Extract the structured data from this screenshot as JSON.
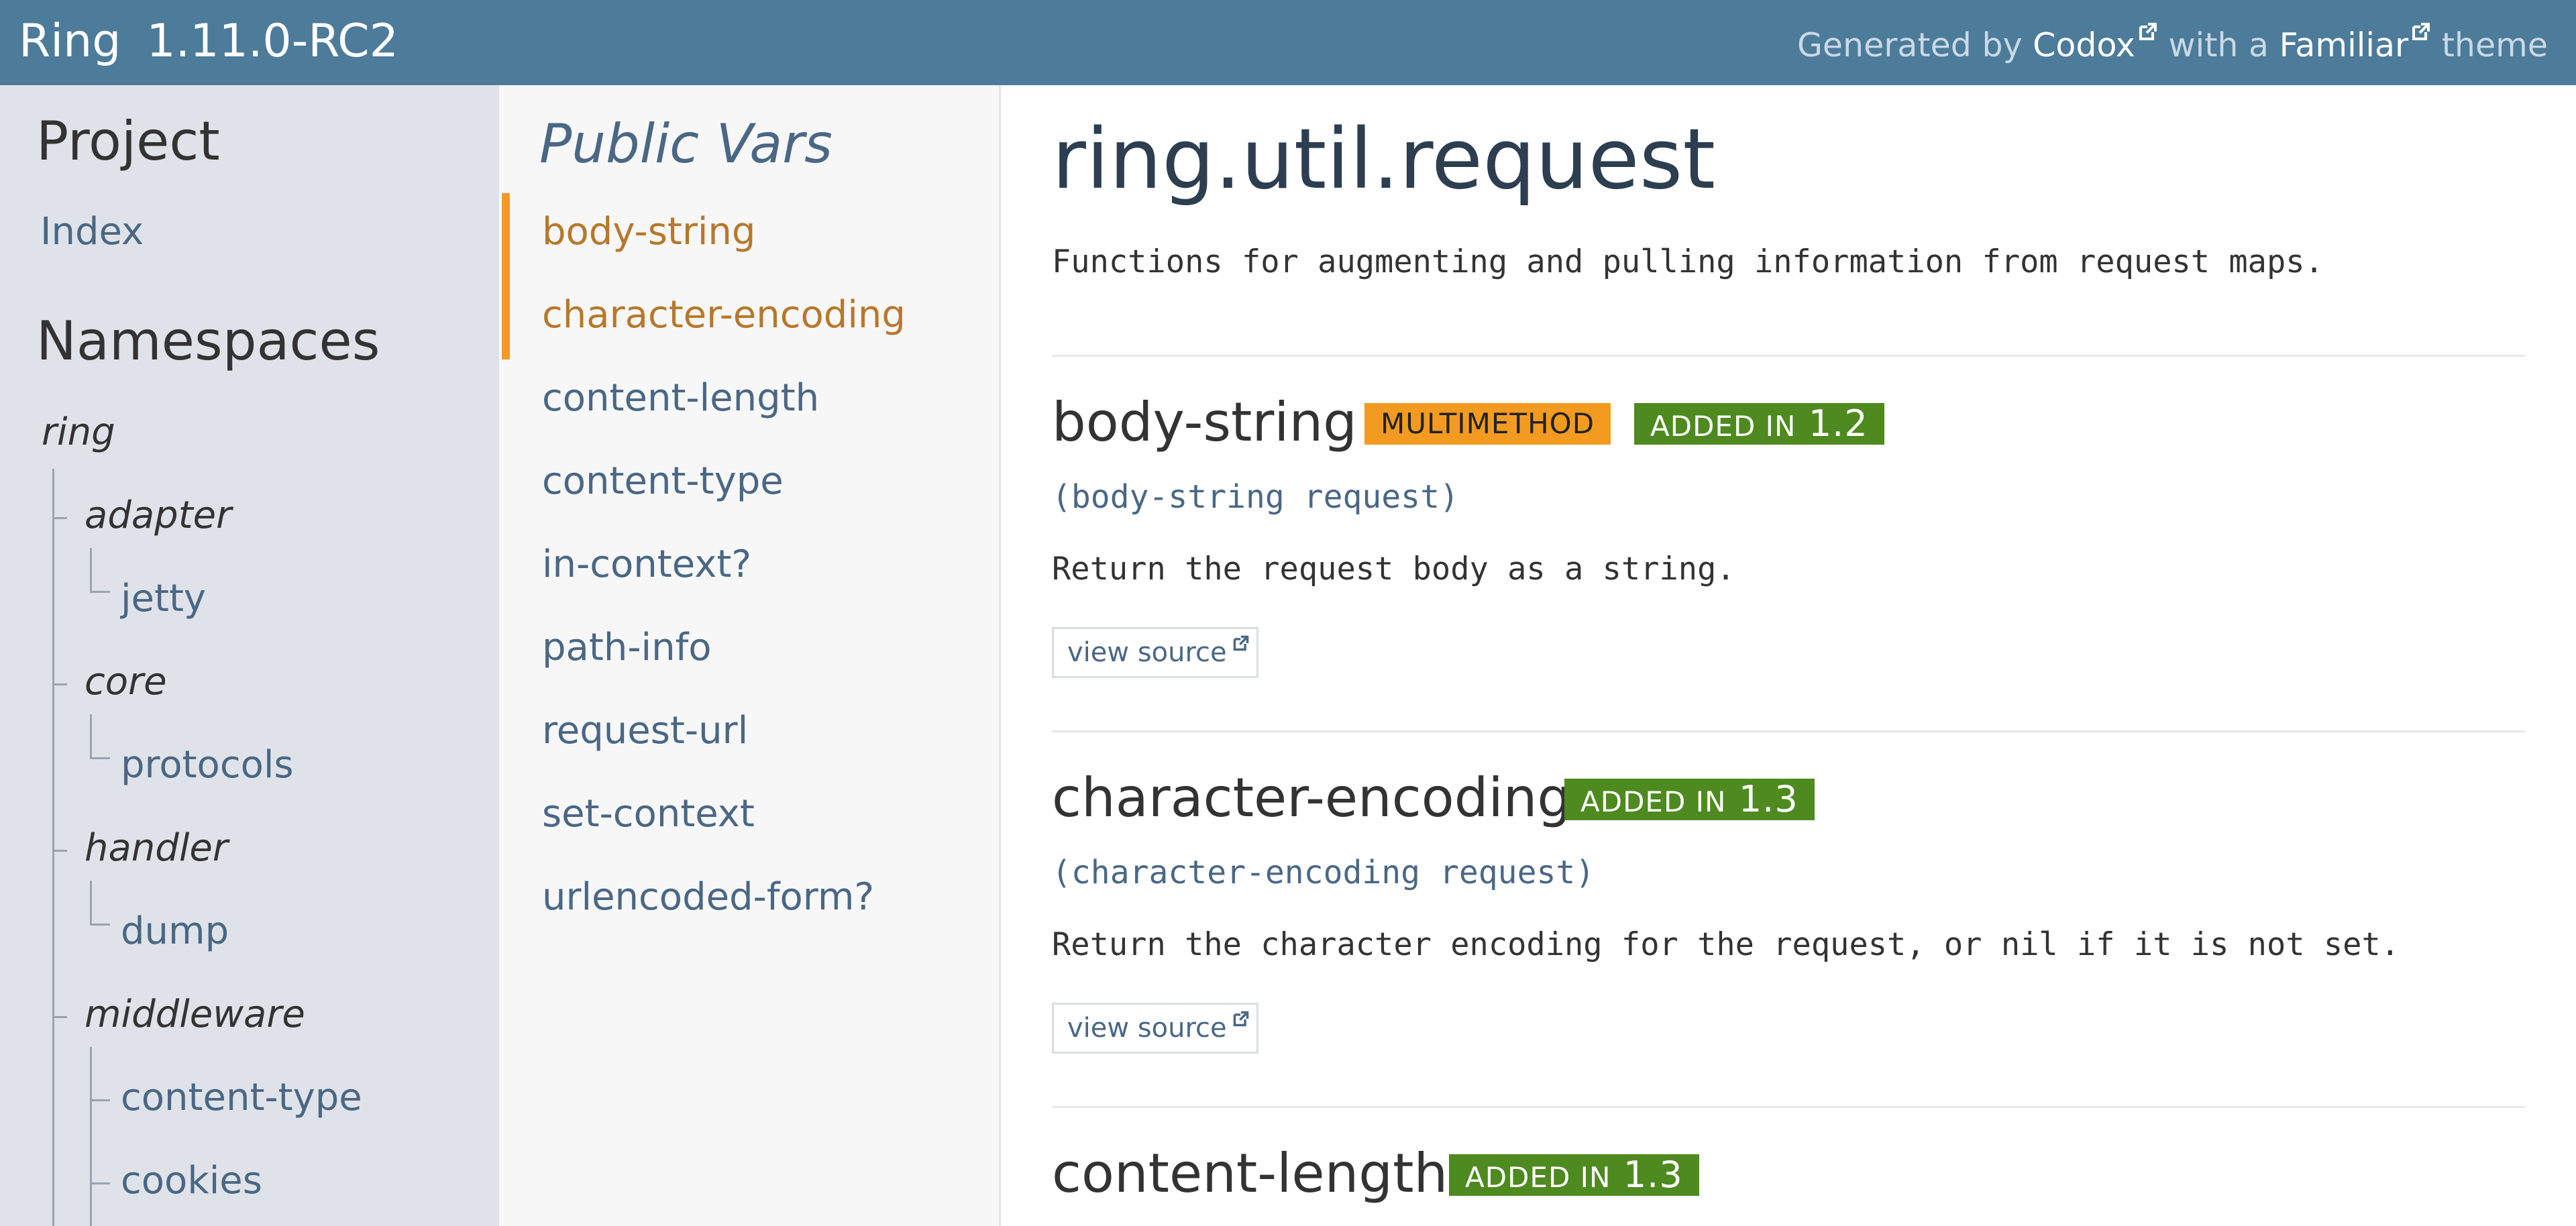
{
  "header": {
    "project": "Ring",
    "version": "1.11.0-RC2",
    "credit_prefix": "Generated by ",
    "credit_tool": "Codox",
    "credit_mid": " with a ",
    "credit_theme": "Familiar",
    "credit_suffix": " theme"
  },
  "ns_sidebar": {
    "project_heading": "Project",
    "index_link": "Index",
    "namespaces_heading": "Namespaces",
    "tree": {
      "ring": "ring",
      "adapter": "adapter",
      "jetty": "jetty",
      "core": "core",
      "protocols": "protocols",
      "handler": "handler",
      "dump": "dump",
      "middleware": "middleware",
      "content_type": "content-type",
      "cookies": "cookies"
    }
  },
  "vars_sidebar": {
    "title": "Public Vars",
    "vars": [
      "body-string",
      "character-encoding",
      "content-length",
      "content-type",
      "in-context?",
      "path-info",
      "request-url",
      "set-context",
      "urlencoded-form?"
    ]
  },
  "content": {
    "namespace": "ring.util.request",
    "doc": "Functions for augmenting and pulling information from request maps.",
    "view_source_label": "view source",
    "added_in_label": "ADDED IN",
    "vars": [
      {
        "name": "body-string",
        "badge": "MULTIMETHOD",
        "added": "1.2",
        "usage": "(body-string request)",
        "doc": "Return the request body as a string."
      },
      {
        "name": "character-encoding",
        "added": "1.3",
        "usage": "(character-encoding request)",
        "doc": "Return the character encoding for the request, or nil if it is not set."
      },
      {
        "name": "content-length",
        "added": "1.3"
      }
    ]
  },
  "colors": {
    "header_bg": "#4d7b9a",
    "accent_orange": "#f39b20",
    "added_green": "#4e8a1f",
    "link": "#4a6785",
    "active_link": "#b7782c"
  }
}
